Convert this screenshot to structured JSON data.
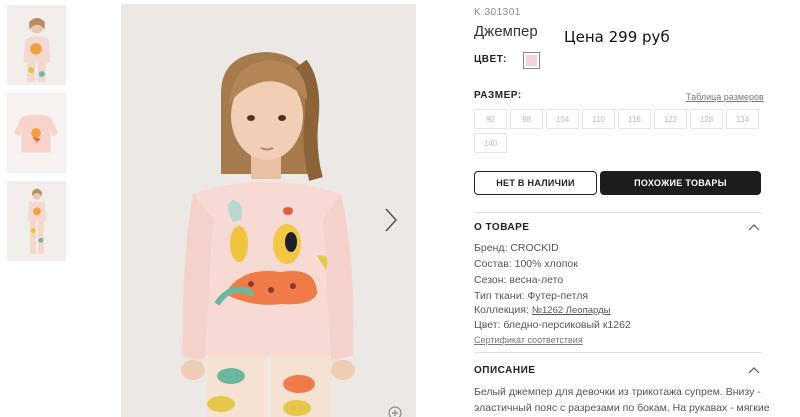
{
  "thumbnails": [
    {
      "name": "thumb-front-full"
    },
    {
      "name": "thumb-sweater-flat"
    },
    {
      "name": "thumb-side-full"
    }
  ],
  "product": {
    "article": "K 301301",
    "title": "Джемпер",
    "price": "Цена 299 руб",
    "color_label": "ЦВЕТ:",
    "color_swatch": "#f6cfe0",
    "size_label": "РАЗМЕР:",
    "size_table_link": "Таблица размеров",
    "sizes": [
      "92",
      "98",
      "104",
      "110",
      "116",
      "122",
      "128",
      "134",
      "140"
    ]
  },
  "actions": {
    "out_of_stock": "НЕТ В НАЛИЧИИ",
    "similar": "ПОХОЖИЕ ТОВАРЫ"
  },
  "about": {
    "title": "О ТОВАРЕ",
    "brand": "Бренд: CROCKID",
    "composition": "Состав: 100% хлопок",
    "season": "Сезон: весна-лето",
    "fabric": "Тип ткани: Футер-петля",
    "collection_prefix": "Коллекция: ",
    "collection_link": "№1262 Леопарды",
    "color": "Цвет: бледно-персиковый к1262",
    "certificate": "Сертификат соответствия"
  },
  "description": {
    "title": "ОПИСАНИЕ",
    "line1": "Белый джемпер для девочки из трикотажа супрем. Внизу -",
    "line2": "эластичный пояс с разрезами по бокам. На рукавах - мягкие"
  }
}
